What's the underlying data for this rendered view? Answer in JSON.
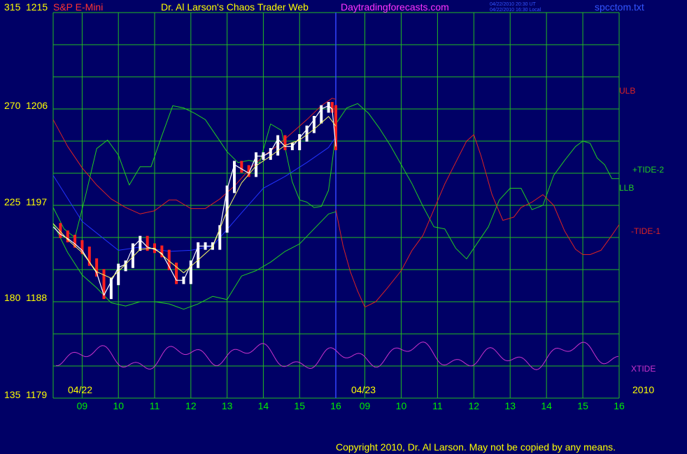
{
  "header": {
    "instrument": "S&P E-Mini",
    "title": "Dr. Al Larson's Chaos Trader Web",
    "site": "Daytradingforecasts.com",
    "stamp_line1": "04/22/2010 20:30 UT",
    "stamp_line2": "04/22/2010 16:30 Local",
    "file": "spcctom.txt"
  },
  "footer": {
    "copyright": "Copyright 2010, Dr. Al Larson. May not be copied by any means."
  },
  "colors": {
    "background": "#000066",
    "grid": "#22bb22",
    "axis": "#ffff00",
    "price": "#ffffff",
    "price_down": "#ff2020",
    "tide_red": "#dd2222",
    "tide_green": "#22cc22",
    "ma_blue": "#2233ff",
    "ma_yellow": "#ffff66",
    "xtide": "#cc33cc",
    "day_divider": "#3344ff"
  },
  "chart_data": {
    "type": "line",
    "y_labels": [
      {
        "left": "315",
        "right": "1215"
      },
      {
        "left": "270",
        "right": "1206"
      },
      {
        "left": "225",
        "right": "1197"
      },
      {
        "left": "180",
        "right": "1188"
      },
      {
        "left": "135",
        "right": "1179"
      }
    ],
    "ylim": [
      1179,
      1215
    ],
    "date_labels": [
      "04/22",
      "04/23"
    ],
    "year_label": "2010",
    "x_ticks": [
      "09",
      "10",
      "11",
      "12",
      "13",
      "14",
      "15",
      "16",
      "09",
      "10",
      "11",
      "12",
      "13",
      "14",
      "15",
      "16"
    ],
    "xlim": [
      8.2,
      16
    ],
    "legend": [
      {
        "label": "ULB",
        "color": "#dd2222"
      },
      {
        "label": "+TIDE-2",
        "color": "#22cc22"
      },
      {
        "label": "LLB",
        "color": "#22cc22"
      },
      {
        "label": "-TIDE-1",
        "color": "#dd2222"
      },
      {
        "label": "XTIDE",
        "color": "#cc33cc"
      }
    ],
    "day1_price_close": {
      "x": [
        8.2,
        8.4,
        8.6,
        8.8,
        9.0,
        9.2,
        9.4,
        9.6,
        9.8,
        10.0,
        10.2,
        10.4,
        10.6,
        10.8,
        11.0,
        11.2,
        11.4,
        11.6,
        11.8,
        12.0,
        12.2,
        12.4,
        12.6,
        12.8,
        13.0,
        13.2,
        13.4,
        13.6,
        13.8,
        14.0,
        14.2,
        14.4,
        14.6,
        14.8,
        15.0,
        15.2,
        15.4,
        15.6,
        15.8,
        15.9,
        16.0
      ],
      "y": [
        1195.0,
        1194.3,
        1193.9,
        1193.4,
        1192.8,
        1191.7,
        1190.7,
        1188.6,
        1189.9,
        1191.2,
        1191.5,
        1193.1,
        1193.8,
        1193.1,
        1192.9,
        1192.5,
        1191.3,
        1190.0,
        1190.0,
        1191.5,
        1193.2,
        1193.2,
        1193.2,
        1194.8,
        1198.5,
        1200.8,
        1200.4,
        1200.0,
        1201.6,
        1201.6,
        1202.0,
        1203.2,
        1202.5,
        1202.5,
        1203.3,
        1204.1,
        1205.0,
        1206.0,
        1206.3,
        1206.0,
        1202.5
      ]
    },
    "day1_ma_fast": {
      "x": [
        8.2,
        8.6,
        9.0,
        9.4,
        9.8,
        10.2,
        10.6,
        11.0,
        11.4,
        11.8,
        12.2,
        12.6,
        13.0,
        13.4,
        13.8,
        14.2,
        14.6,
        15.0,
        15.4,
        15.8,
        16.0
      ],
      "y": [
        1195.3,
        1193.8,
        1192.6,
        1190.8,
        1190.2,
        1191.5,
        1192.9,
        1193.0,
        1191.8,
        1190.7,
        1191.9,
        1193.1,
        1196.5,
        1199.1,
        1200.7,
        1201.6,
        1202.6,
        1203.1,
        1204.1,
        1205.3,
        1204.4
      ]
    },
    "day1_ma_slow": {
      "x": [
        8.2,
        9.0,
        10.0,
        10.6,
        11.4,
        12.0,
        12.6,
        13.4,
        14.0,
        14.6,
        15.2,
        15.8,
        16.0
      ],
      "y": [
        1199.8,
        1195.5,
        1192.8,
        1193.1,
        1192.7,
        1192.8,
        1193.2,
        1196.3,
        1198.6,
        1199.7,
        1201.0,
        1202.4,
        1203.4
      ]
    },
    "ulb": {
      "x": [
        8.2,
        8.6,
        9.0,
        9.4,
        9.8,
        10.2,
        10.6,
        11.0,
        11.4,
        11.6,
        11.8,
        12.0,
        12.4,
        12.8,
        13.2,
        13.6,
        14.0,
        14.4,
        14.8,
        15.2,
        15.6,
        15.9,
        16.0
      ],
      "y": [
        1205.0,
        1202.5,
        1200.5,
        1198.9,
        1197.6,
        1196.8,
        1196.2,
        1196.5,
        1197.5,
        1197.5,
        1197.1,
        1196.7,
        1196.7,
        1197.6,
        1198.8,
        1200.3,
        1201.6,
        1202.6,
        1203.8,
        1205.0,
        1206.3,
        1207.0,
        1206.9
      ]
    },
    "llb": {
      "x": [
        8.2,
        8.6,
        9.0,
        9.4,
        9.8,
        10.2,
        10.6,
        11.0,
        11.4,
        11.8,
        12.2,
        12.6,
        13.0,
        13.4,
        13.8,
        14.2,
        14.6,
        15.0,
        15.4,
        15.8,
        16.0
      ],
      "y": [
        1195.3,
        1192.6,
        1190.5,
        1189.3,
        1187.9,
        1187.6,
        1188.0,
        1188.0,
        1187.8,
        1187.3,
        1187.8,
        1188.5,
        1188.2,
        1190.4,
        1190.9,
        1191.7,
        1192.7,
        1193.4,
        1194.8,
        1196.2,
        1196.4
      ]
    },
    "tide_green_day1": {
      "x": [
        8.2,
        8.5,
        8.8,
        9.1,
        9.4,
        9.7,
        10.0,
        10.3,
        10.6,
        10.9,
        11.2,
        11.5,
        11.8,
        12.1,
        12.4,
        12.7,
        13.0,
        13.3,
        13.6,
        13.9,
        14.2,
        14.5,
        14.8,
        15.0,
        15.2,
        15.4,
        15.6,
        15.8,
        15.9,
        16.0
      ],
      "y": [
        1196.8,
        1194.8,
        1194.0,
        1198.0,
        1202.3,
        1203.1,
        1201.7,
        1198.9,
        1200.6,
        1200.6,
        1203.5,
        1206.3,
        1206.1,
        1205.6,
        1205.0,
        1203.5,
        1202.0,
        1201.0,
        1201.2,
        1201.0,
        1204.6,
        1204.0,
        1199.2,
        1197.5,
        1197.3,
        1196.8,
        1196.9,
        1198.4,
        1201.0,
        1203.8
      ]
    },
    "tide_green_day2": {
      "x": [
        8.2,
        8.5,
        8.8,
        9.1,
        9.4,
        9.7,
        10.0,
        10.3,
        10.6,
        10.9,
        11.2,
        11.5,
        11.8,
        12.1,
        12.4,
        12.7,
        13.0,
        13.3,
        13.6,
        13.9,
        14.2,
        14.5,
        14.8,
        15.0,
        15.2,
        15.4,
        15.6,
        15.8,
        16.0
      ],
      "y": [
        1204.6,
        1206.1,
        1206.5,
        1205.6,
        1204.2,
        1202.6,
        1200.8,
        1199.0,
        1196.9,
        1195.0,
        1194.8,
        1193.0,
        1192.0,
        1193.5,
        1195.0,
        1197.5,
        1198.6,
        1198.6,
        1196.6,
        1197.0,
        1199.8,
        1201.2,
        1202.5,
        1203.0,
        1202.8,
        1201.4,
        1200.8,
        1199.5,
        1199.5
      ]
    },
    "tide_red_day2": {
      "x": [
        8.2,
        8.4,
        8.6,
        8.8,
        9.0,
        9.3,
        9.6,
        10.0,
        10.3,
        10.6,
        10.9,
        11.2,
        11.5,
        11.8,
        12.0,
        12.2,
        12.5,
        12.8,
        13.1,
        13.3,
        13.6,
        13.9,
        14.2,
        14.5,
        14.8,
        15.0,
        15.2,
        15.5,
        15.8,
        16.0
      ],
      "y": [
        1196.6,
        1193.2,
        1190.8,
        1189.0,
        1187.5,
        1188.0,
        1189.2,
        1190.9,
        1192.8,
        1194.2,
        1196.6,
        1199.0,
        1201.0,
        1203.0,
        1203.6,
        1201.6,
        1198.0,
        1195.6,
        1195.9,
        1196.8,
        1197.3,
        1198.0,
        1197.0,
        1194.6,
        1192.9,
        1192.4,
        1192.4,
        1192.8,
        1194.2,
        1195.2
      ]
    }
  }
}
